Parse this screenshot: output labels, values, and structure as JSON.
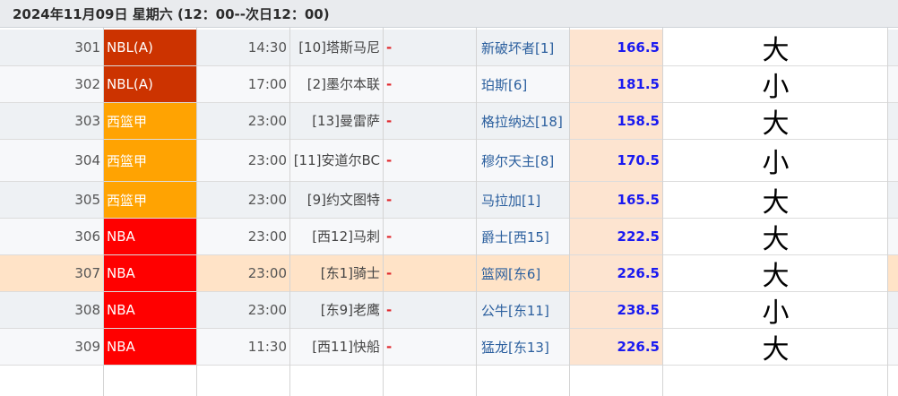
{
  "header": {
    "title": "2024年11月09日 星期六 (12：00--次日12：00)"
  },
  "rows": [
    {
      "id": "301",
      "league": "NBL(A)",
      "league_color": "#cc3300",
      "time": "14:30",
      "home": "[10]塔斯马尼",
      "dash": "-",
      "away": "新破坏者[1]",
      "score": "166.5",
      "result": "大"
    },
    {
      "id": "302",
      "league": "NBL(A)",
      "league_color": "#cc3300",
      "time": "17:00",
      "home": "[2]墨尔本联",
      "dash": "-",
      "away": "珀斯[6]",
      "score": "181.5",
      "result": "小"
    },
    {
      "id": "303",
      "league": "西篮甲",
      "league_color": "#ffa302",
      "time": "23:00",
      "home": "[13]曼雷萨",
      "dash": "-",
      "away": "格拉纳达[18]",
      "score": "158.5",
      "result": "大"
    },
    {
      "id": "304",
      "league": "西篮甲",
      "league_color": "#ffa302",
      "time": "23:00",
      "home": "[11]安道尔BC",
      "dash": "-",
      "away": "穆尔天主[8]",
      "score": "170.5",
      "result": "小"
    },
    {
      "id": "305",
      "league": "西篮甲",
      "league_color": "#ffa302",
      "time": "23:00",
      "home": "[9]约文图特",
      "dash": "-",
      "away": "马拉加[1]",
      "score": "165.5",
      "result": "大"
    },
    {
      "id": "306",
      "league": "NBA",
      "league_color": "#ff0000",
      "time": "23:00",
      "home": "[西12]马刺",
      "dash": "-",
      "away": "爵士[西15]",
      "score": "222.5",
      "result": "大"
    },
    {
      "id": "307",
      "league": "NBA",
      "league_color": "#ff0000",
      "time": "23:00",
      "home": "[东1]骑士",
      "dash": "-",
      "away": "篮网[东6]",
      "score": "226.5",
      "result": "大"
    },
    {
      "id": "308",
      "league": "NBA",
      "league_color": "#ff0000",
      "time": "23:00",
      "home": "[东9]老鹰",
      "dash": "-",
      "away": "公牛[东11]",
      "score": "238.5",
      "result": "小"
    },
    {
      "id": "309",
      "league": "NBA",
      "league_color": "#ff0000",
      "time": "11:30",
      "home": "[西11]快船",
      "dash": "-",
      "away": "猛龙[东13]",
      "score": "226.5",
      "result": "大"
    }
  ]
}
